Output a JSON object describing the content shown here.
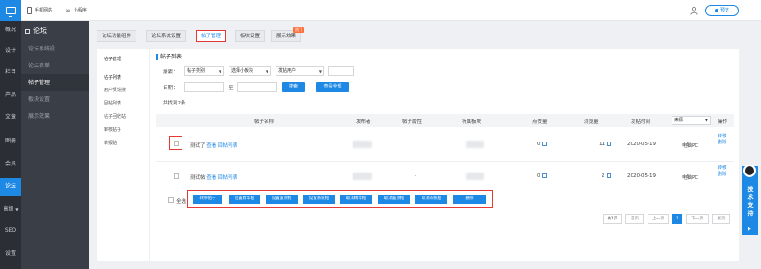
{
  "left_nav": [
    {
      "label": "概况",
      "top": 0
    },
    {
      "label": "设计"
    },
    {
      "label": "栏目"
    },
    {
      "label": "产品"
    },
    {
      "label": "文章"
    },
    {
      "label": "图册"
    },
    {
      "label": "会员"
    },
    {
      "label": "论坛",
      "active": true
    },
    {
      "label": "高级"
    },
    {
      "label": "SEO"
    },
    {
      "label": "设置"
    }
  ],
  "subnav": {
    "title": "论坛",
    "items": [
      "论坛系统设...",
      "论坛表单",
      "帖子管理",
      "板块设置",
      "展示效果"
    ],
    "active_index": 2
  },
  "topbar": {
    "mobile_site": "手机网站",
    "mini_program": "小程序",
    "preview": "预览"
  },
  "tabs": [
    "论坛功能组件",
    "论坛系统设置",
    "帖子管理",
    "板块设置",
    "展示效果"
  ],
  "tab_hot_badge": "热门",
  "inner_nav": {
    "head": "帖子管理",
    "items": [
      "帖子列表",
      "用户反馈搜",
      "回帖列表",
      "帖子回收站",
      "审核帖子",
      "举报贴"
    ]
  },
  "section_title": "帖子列表",
  "search": {
    "label": "搜索：",
    "category": "帖子类别",
    "board": "选择小板块",
    "poster": "发帖用户",
    "date_label": "日期：",
    "to": "至",
    "search_btn": "搜索",
    "view_all_btn": "查看全部"
  },
  "result_count": "共找到2条",
  "table": {
    "headers": [
      "帖子名称",
      "发布者",
      "帖子属性",
      "所属板块",
      "点赞量",
      "浏览量",
      "发贴时间",
      "来源",
      "操作"
    ],
    "sort_select": "来源",
    "rows": [
      {
        "title": "测试了",
        "view": "查看",
        "reply_list": "回帖列表",
        "attr": "",
        "likes": "0",
        "views": "11",
        "date": "2020-05-19",
        "source": "电脑PC",
        "ops": [
          "转移",
          "删除"
        ]
      },
      {
        "title": "测试帖",
        "view": "查看",
        "reply_list": "回帖列表",
        "attr": "-",
        "likes": "0",
        "views": "2",
        "date": "2020-05-19",
        "source": "电脑PC",
        "ops": [
          "转移",
          "删除"
        ]
      }
    ]
  },
  "select_all": "全选",
  "bulk_actions": [
    "转移帖子",
    "设置精华帖",
    "设置置顶帖",
    "设置系统帖",
    "取消精华帖",
    "取消置顶帖",
    "取消系统帖",
    "删除"
  ],
  "pager": {
    "total": "共1页",
    "first": "首页",
    "prev": "上一页",
    "current": "1",
    "next": "下一页",
    "last": "尾页"
  },
  "support": "技术支持"
}
